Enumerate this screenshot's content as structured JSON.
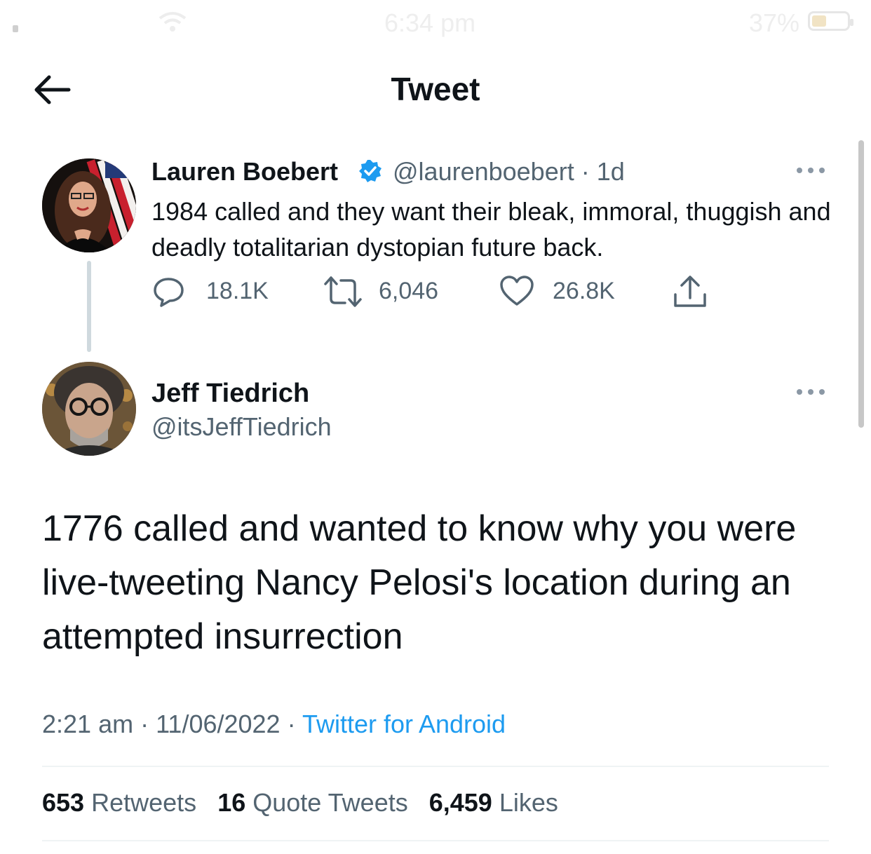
{
  "status_bar": {
    "time": "6:34 pm",
    "battery": "37%"
  },
  "header": {
    "title": "Tweet"
  },
  "parent_tweet": {
    "name": "Lauren Boebert",
    "handle_time": "@laurenboebert · 1d",
    "text": "1984 called and they want their bleak, immoral, thuggish and deadly totalitarian dystopian future back.",
    "replies": "18.1K",
    "retweets": "6,046",
    "likes": "26.8K"
  },
  "main_tweet": {
    "name": "Jeff Tiedrich",
    "handle": "@itsJeffTiedrich",
    "text": "1776 called and wanted to know why you were live-tweeting Nancy Pelosi's location during an attempted insurrection",
    "time": "2:21 am",
    "date": "11/06/2022",
    "source": "Twitter for Android"
  },
  "stats": {
    "retweets_count": "653",
    "retweets_label": "Retweets",
    "quotes_count": "16",
    "quotes_label": "Quote Tweets",
    "likes_count": "6,459",
    "likes_label": "Likes"
  },
  "colors": {
    "accent": "#1d9bf0",
    "muted": "#536471",
    "text": "#0f1419"
  }
}
